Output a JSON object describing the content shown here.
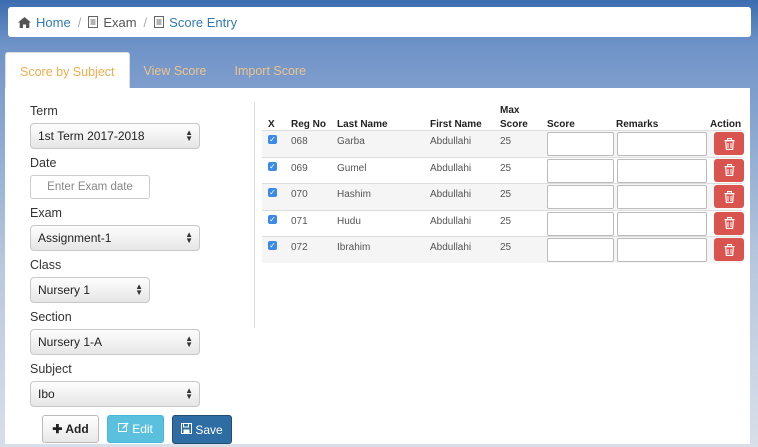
{
  "breadcrumb": {
    "home": "Home",
    "exam": "Exam",
    "score_entry": "Score Entry"
  },
  "tabs": [
    {
      "label": "Score by Subject",
      "active": true
    },
    {
      "label": "View Score",
      "active": false
    },
    {
      "label": "Import Score",
      "active": false
    }
  ],
  "form": {
    "term_label": "Term",
    "term_value": "1st Term 2017-2018",
    "date_label": "Date",
    "date_placeholder": "Enter Exam date",
    "exam_label": "Exam",
    "exam_value": "Assignment-1",
    "class_label": "Class",
    "class_value": "Nursery 1",
    "section_label": "Section",
    "section_value": "Nursery 1-A",
    "subject_label": "Subject",
    "subject_value": "Ibo"
  },
  "buttons": {
    "add": "Add",
    "edit": "Edit",
    "save": "Save"
  },
  "table": {
    "headers": {
      "x": "X",
      "reg_no": "Reg No",
      "last_name": "Last Name",
      "first_name": "First Name",
      "max_score_1": "Max",
      "max_score_2": "Score",
      "score": "Score",
      "remarks": "Remarks",
      "action": "Action"
    },
    "rows": [
      {
        "checked": true,
        "reg_no": "068",
        "last_name": "Garba",
        "first_name": "Abdullahi",
        "max_score": "25",
        "score": "",
        "remarks": ""
      },
      {
        "checked": true,
        "reg_no": "069",
        "last_name": "Gumel",
        "first_name": "Abdullahi",
        "max_score": "25",
        "score": "",
        "remarks": ""
      },
      {
        "checked": true,
        "reg_no": "070",
        "last_name": "Hashim",
        "first_name": "Abdullahi",
        "max_score": "25",
        "score": "",
        "remarks": ""
      },
      {
        "checked": true,
        "reg_no": "071",
        "last_name": "Hudu",
        "first_name": "Abdullahi",
        "max_score": "25",
        "score": "",
        "remarks": ""
      },
      {
        "checked": true,
        "reg_no": "072",
        "last_name": "Ibrahim",
        "first_name": "Abdullahi",
        "max_score": "25",
        "score": "",
        "remarks": ""
      }
    ]
  },
  "colors": {
    "tab_active": "#f0ad4e",
    "edit_button": "#5bc0de",
    "save_button": "#2e6da4",
    "delete_button": "#d9534f",
    "checkbox": "#3b8be6"
  },
  "icons": {
    "home": "home-icon",
    "exam": "document-icon",
    "score_entry": "document-icon",
    "add": "plus-icon",
    "edit": "edit-icon",
    "save": "floppy-icon",
    "delete": "trash-icon"
  }
}
